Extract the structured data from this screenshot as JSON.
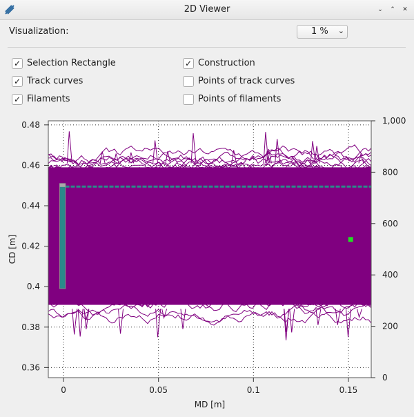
{
  "window": {
    "title": "2D Viewer",
    "controls": [
      "minimize-icon",
      "maximize-icon",
      "close-icon"
    ]
  },
  "visualization": {
    "label": "Visualization:",
    "value": "1 %"
  },
  "checkboxes": [
    {
      "label": "Selection Rectangle",
      "checked": true
    },
    {
      "label": "Construction",
      "checked": true
    },
    {
      "label": "Track curves",
      "checked": true
    },
    {
      "label": "Points of track curves",
      "checked": false
    },
    {
      "label": "Filaments",
      "checked": true
    },
    {
      "label": "Points of filaments",
      "checked": false
    }
  ],
  "chart_data": {
    "type": "line",
    "xlabel": "MD [m]",
    "ylabel": "CD [m]",
    "xlim": [
      -0.008,
      0.162
    ],
    "ylim": [
      0.355,
      0.482
    ],
    "x_ticks": [
      "0",
      "0.05",
      "0.1",
      "0.15"
    ],
    "y_ticks": [
      "0.36",
      "0.38",
      "0.4",
      "0.42",
      "0.44",
      "0.46",
      "0.48"
    ],
    "y2_ticks": [
      "0",
      "200",
      "400",
      "600",
      "800",
      "1,000"
    ],
    "y2lim": [
      0,
      1000
    ],
    "grid": true,
    "filament_band": {
      "cd_min": 0.385,
      "cd_max": 0.465,
      "color": "#800080"
    },
    "selection_rectangle": {
      "md_min": -0.002,
      "md_max": 0.001,
      "cd_min": 0.399,
      "cd_max": 0.451,
      "color": "#2a8a8a"
    },
    "track_line": {
      "cd": 0.4495,
      "md_min": -0.002,
      "md_max": 0.162,
      "color": "#2a8a8a"
    },
    "point_marker": {
      "md": 0.151,
      "cd": 0.4235,
      "color": "#22dd22"
    }
  }
}
